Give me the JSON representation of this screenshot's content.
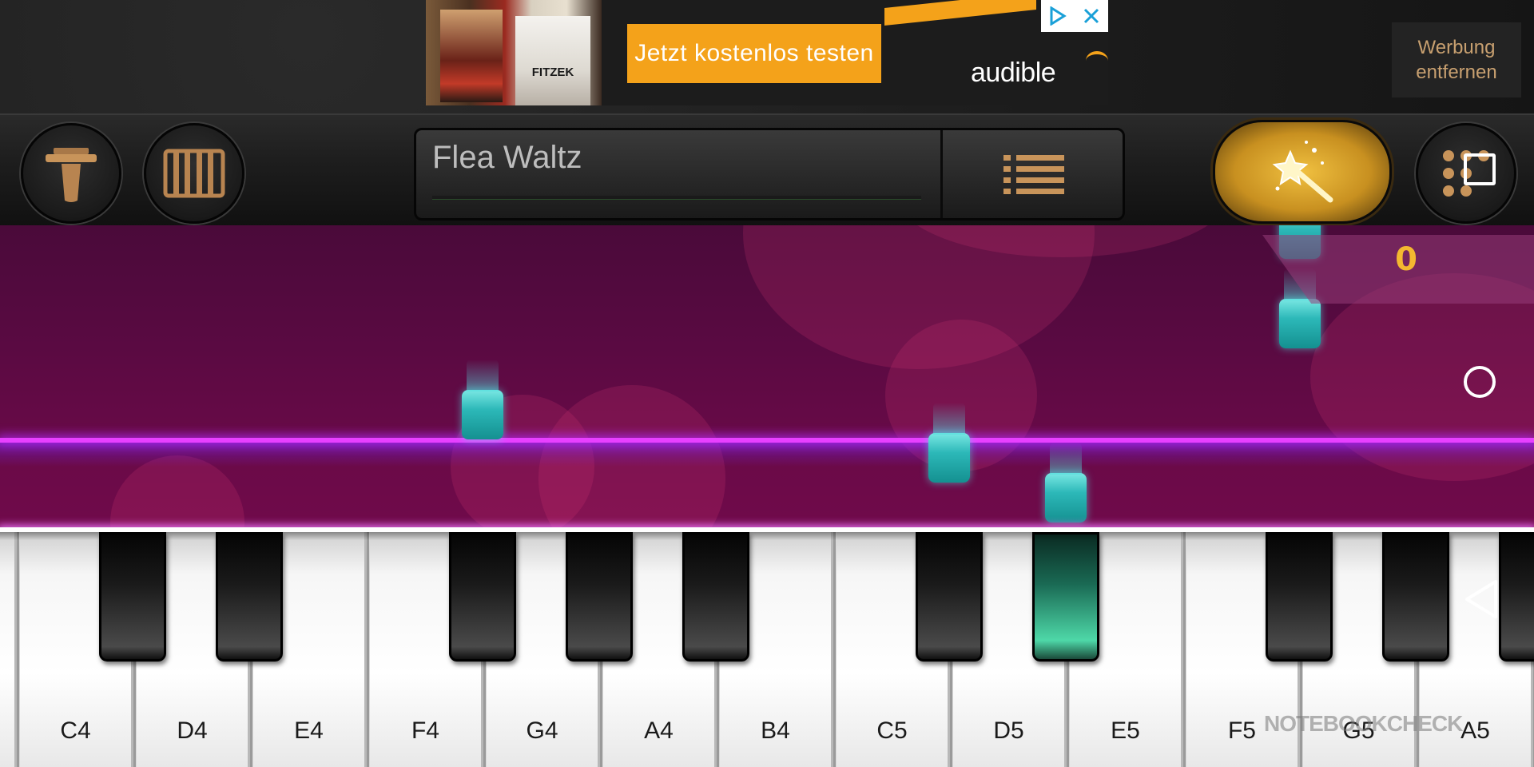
{
  "ad": {
    "book_title": "FITZEK",
    "cta_label": "Jetzt kostenlos testen",
    "brand": "audible",
    "adchoices_icon": "adchoices-icon",
    "close_icon": "close-icon"
  },
  "toolbar": {
    "remove_ads_label": "Werbung entfernen",
    "metronome_icon": "metronome-icon",
    "keyboard_icon": "piano-keys-icon",
    "song_title": "Flea Waltz",
    "song_progress": 0,
    "song_list_icon": "list-icon",
    "magic_icon": "magic-wand-icon",
    "grid_icon": "grid-icon"
  },
  "game": {
    "score": "0"
  },
  "keyboard": {
    "white_keys": [
      "C4",
      "D4",
      "E4",
      "F4",
      "G4",
      "A4",
      "B4",
      "C5",
      "D5",
      "E5",
      "F5",
      "G5",
      "A5"
    ],
    "lit_key": "D#5"
  },
  "watermark": "NOTEBOOKCHECK",
  "colors": {
    "accent_gold": "#f4b830",
    "note_teal": "#2cb8b8",
    "hitline": "#e840ff",
    "ad_orange": "#f4a21a"
  }
}
